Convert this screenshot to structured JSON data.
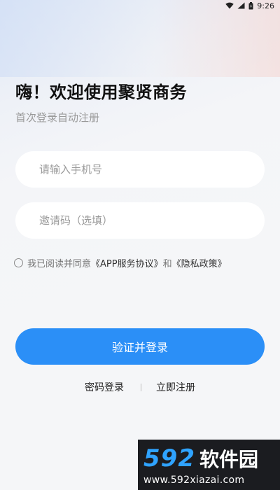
{
  "status_bar": {
    "time": "9:26"
  },
  "header": {
    "title": "嗨！欢迎使用聚贤商务",
    "subtitle": "首次登录自动注册"
  },
  "form": {
    "phone_placeholder": "请输入手机号",
    "phone_value": "",
    "invite_placeholder": "邀请码（选填）",
    "invite_value": ""
  },
  "agreement": {
    "checked": false,
    "prefix": "我已阅读并同意",
    "app_service_link": "《APP服务协议》",
    "conjunction": "和",
    "privacy_link": "《隐私政策》"
  },
  "actions": {
    "login_label": "验证并登录",
    "password_login": "密码登录",
    "register_now": "立即注册"
  },
  "watermark": {
    "number": "592",
    "name": "软件园",
    "url": "www.592xiazai.com"
  },
  "colors": {
    "primary": "#2b8ff7",
    "watermark_blue": "#2fa3ff"
  }
}
